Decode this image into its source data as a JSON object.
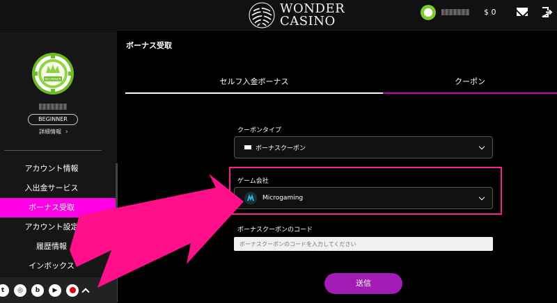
{
  "header": {
    "logo_line1": "WONDER",
    "logo_line2": "CASINO",
    "balance": "$ 0",
    "icons": [
      "player-avatar-icon",
      "mail-icon",
      "logout-icon"
    ]
  },
  "sidebar": {
    "badge_text": "BEGINNER",
    "level": "BEGINNER",
    "detail_link": "詳細情報",
    "menu": [
      {
        "label": "アカウント情報",
        "active": false
      },
      {
        "label": "入出金サービス",
        "active": false
      },
      {
        "label": "ボーナス受取",
        "active": true
      },
      {
        "label": "アカウント設定",
        "active": false
      },
      {
        "label": "履歴情報",
        "active": false
      },
      {
        "label": "インボックス",
        "active": false
      }
    ],
    "social_icons": [
      "twitter-icon",
      "instagram-icon",
      "bitly-icon",
      "youtube-icon",
      "record-icon",
      "chevron-up-icon"
    ]
  },
  "main": {
    "page_title": "ボーナス受取",
    "tabs": [
      {
        "label": "セルフ入金ボーナス",
        "active": false
      },
      {
        "label": "クーポン",
        "active": true
      }
    ],
    "coupon_type": {
      "label": "クーポンタイプ",
      "value": "ボーナスクーポン"
    },
    "game_provider": {
      "label": "ゲーム会社",
      "value": "Microgaming"
    },
    "coupon_code": {
      "label": "ボーナスクーポンのコード",
      "placeholder": "ボーナスクーポンのコードを入力してください",
      "value": ""
    },
    "submit_label": "送信"
  },
  "colors": {
    "accent_pink": "#ff00e6",
    "tab_underline": "#d100c4",
    "submit_purple": "#a21bb4",
    "highlight_border": "#ff1e8f",
    "badge_green": "#7ccc2e"
  }
}
